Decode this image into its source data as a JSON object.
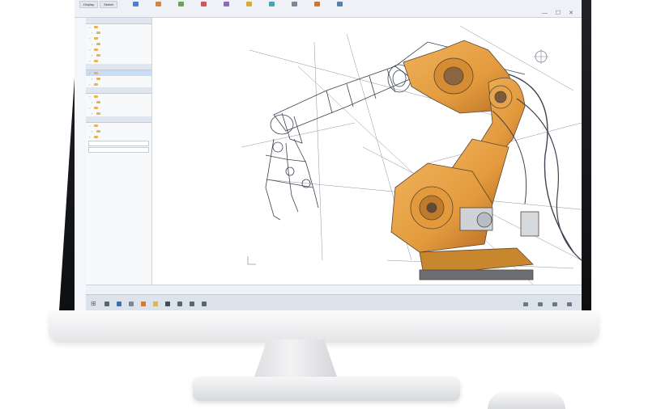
{
  "ribbon": {
    "tabs": [
      "Display",
      "Sketch"
    ],
    "tools": [
      {
        "label": "",
        "color": "#4f7ec2",
        "icon": "part-icon"
      },
      {
        "label": "",
        "color": "#d0864a",
        "icon": "assembly-icon"
      },
      {
        "label": "",
        "color": "#6aa35b",
        "icon": "extrude-icon"
      },
      {
        "label": "",
        "color": "#c45a5a",
        "icon": "revolve-icon"
      },
      {
        "label": "",
        "color": "#8a6cb8",
        "icon": "fillet-icon"
      },
      {
        "label": "",
        "color": "#d9a93b",
        "icon": "measure-icon"
      },
      {
        "label": "",
        "color": "#4d9fb5",
        "icon": "simulate-icon"
      },
      {
        "label": "",
        "color": "#7a8696",
        "icon": "render-icon"
      },
      {
        "label": "",
        "color": "#c7773a",
        "icon": "export-icon"
      },
      {
        "label": "",
        "color": "#5c7fa8",
        "icon": "settings-icon"
      }
    ]
  },
  "window_controls": {
    "minimize": "—",
    "maximize": "☐",
    "close": "✕"
  },
  "left_panel": {
    "sections": [
      {
        "title": "",
        "rows": [
          "",
          "",
          "",
          "",
          "",
          "",
          ""
        ]
      },
      {
        "title": "",
        "rows": [
          "",
          "",
          ""
        ]
      },
      {
        "title": "",
        "rows": [
          "",
          "",
          "",
          ""
        ]
      },
      {
        "title": "",
        "rows": [
          "",
          "",
          ""
        ]
      }
    ],
    "fields": [
      "",
      ""
    ]
  },
  "statusbar": {
    "items": [
      "",
      "",
      ""
    ]
  },
  "taskbar": {
    "icons": [
      {
        "name": "file-explorer-icon",
        "color": "#5a6677"
      },
      {
        "name": "browser-icon",
        "color": "#3a6fb0"
      },
      {
        "name": "mail-icon",
        "color": "#7a8696"
      },
      {
        "name": "cad-app-icon",
        "color": "#d97a2b"
      },
      {
        "name": "folder-icon",
        "color": "#e0b34e"
      },
      {
        "name": "terminal-icon",
        "color": "#434d5a"
      },
      {
        "name": "video-icon",
        "color": "#5a6677"
      },
      {
        "name": "camera-icon",
        "color": "#5a6677"
      },
      {
        "name": "calendar-icon",
        "color": "#5a6677"
      }
    ]
  },
  "colors": {
    "robot_orange": "#e39a3d",
    "robot_dark": "#6b5a45",
    "wire": "#5b6470"
  }
}
